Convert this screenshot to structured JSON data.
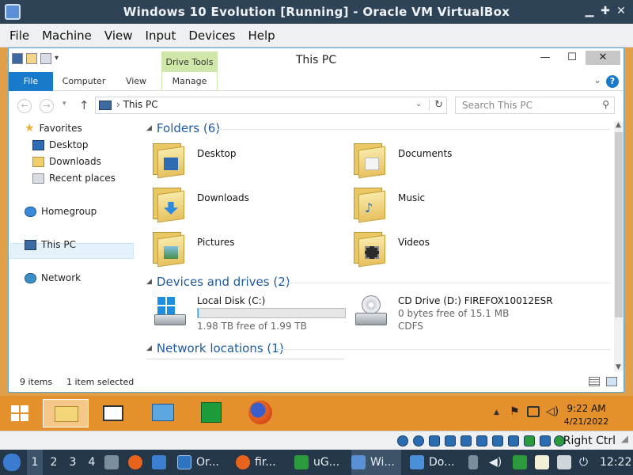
{
  "vbox": {
    "title": "Windows 10 Evolution [Running] - Oracle VM VirtualBox",
    "menus": [
      "File",
      "Machine",
      "View",
      "Input",
      "Devices",
      "Help"
    ],
    "right_ctrl": "Right Ctrl"
  },
  "explorer": {
    "title": "This PC",
    "drive_tools": "Drive Tools",
    "ribbon_tabs": [
      "File",
      "Computer",
      "View",
      "Manage"
    ],
    "address_crumb": "This PC",
    "search_placeholder": "Search This PC",
    "nav": {
      "favorites": "Favorites",
      "desktop": "Desktop",
      "downloads": "Downloads",
      "recent": "Recent places",
      "homegroup": "Homegroup",
      "thispc": "This PC",
      "network": "Network"
    },
    "groups": {
      "folders": "Folders (6)",
      "devices": "Devices and drives (2)",
      "network": "Network locations (1)"
    },
    "folders": [
      "Desktop",
      "Documents",
      "Downloads",
      "Music",
      "Pictures",
      "Videos"
    ],
    "drives": {
      "c_name": "Local Disk (C:)",
      "c_free": "1.98 TB free of 1.99 TB",
      "c_used_fraction": 0.005,
      "d_name": "CD Drive (D:) FIREFOX10012ESR",
      "d_free": "0 bytes free of 15.1 MB",
      "d_fs": "CDFS"
    },
    "status": {
      "items": "9 items",
      "selected": "1 item selected"
    }
  },
  "taskbar8": {
    "time": "9:22 AM",
    "date": "4/21/2022"
  },
  "host": {
    "workspaces": [
      "1",
      "2",
      "3",
      "4"
    ],
    "tasks": [
      "Or...",
      "fir...",
      "uG...",
      "Wi...",
      "Do..."
    ],
    "clock": "12:22"
  },
  "colors": {
    "accent": "#1979ca",
    "guest_taskbar": "#e4902c",
    "host_panel": "#25384a",
    "vbox_titlebar": "#2f4357",
    "drive_tools": "#cfe8a9"
  }
}
